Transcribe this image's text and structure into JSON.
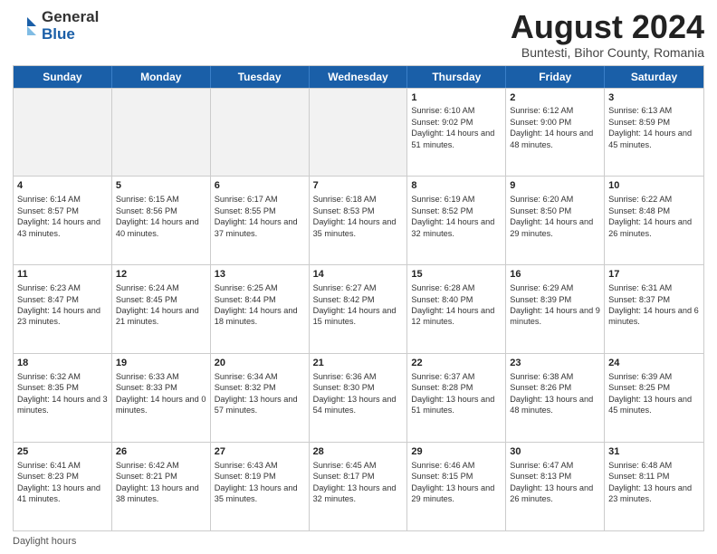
{
  "header": {
    "logo_line1": "General",
    "logo_line2": "Blue",
    "month_title": "August 2024",
    "subtitle": "Buntesti, Bihor County, Romania"
  },
  "calendar": {
    "days_of_week": [
      "Sunday",
      "Monday",
      "Tuesday",
      "Wednesday",
      "Thursday",
      "Friday",
      "Saturday"
    ],
    "rows": [
      [
        {
          "day": "",
          "info": "",
          "shaded": true
        },
        {
          "day": "",
          "info": "",
          "shaded": true
        },
        {
          "day": "",
          "info": "",
          "shaded": true
        },
        {
          "day": "",
          "info": "",
          "shaded": true
        },
        {
          "day": "1",
          "info": "Sunrise: 6:10 AM\nSunset: 9:02 PM\nDaylight: 14 hours and 51 minutes.",
          "shaded": false
        },
        {
          "day": "2",
          "info": "Sunrise: 6:12 AM\nSunset: 9:00 PM\nDaylight: 14 hours and 48 minutes.",
          "shaded": false
        },
        {
          "day": "3",
          "info": "Sunrise: 6:13 AM\nSunset: 8:59 PM\nDaylight: 14 hours and 45 minutes.",
          "shaded": false
        }
      ],
      [
        {
          "day": "4",
          "info": "Sunrise: 6:14 AM\nSunset: 8:57 PM\nDaylight: 14 hours and 43 minutes.",
          "shaded": false
        },
        {
          "day": "5",
          "info": "Sunrise: 6:15 AM\nSunset: 8:56 PM\nDaylight: 14 hours and 40 minutes.",
          "shaded": false
        },
        {
          "day": "6",
          "info": "Sunrise: 6:17 AM\nSunset: 8:55 PM\nDaylight: 14 hours and 37 minutes.",
          "shaded": false
        },
        {
          "day": "7",
          "info": "Sunrise: 6:18 AM\nSunset: 8:53 PM\nDaylight: 14 hours and 35 minutes.",
          "shaded": false
        },
        {
          "day": "8",
          "info": "Sunrise: 6:19 AM\nSunset: 8:52 PM\nDaylight: 14 hours and 32 minutes.",
          "shaded": false
        },
        {
          "day": "9",
          "info": "Sunrise: 6:20 AM\nSunset: 8:50 PM\nDaylight: 14 hours and 29 minutes.",
          "shaded": false
        },
        {
          "day": "10",
          "info": "Sunrise: 6:22 AM\nSunset: 8:48 PM\nDaylight: 14 hours and 26 minutes.",
          "shaded": false
        }
      ],
      [
        {
          "day": "11",
          "info": "Sunrise: 6:23 AM\nSunset: 8:47 PM\nDaylight: 14 hours and 23 minutes.",
          "shaded": false
        },
        {
          "day": "12",
          "info": "Sunrise: 6:24 AM\nSunset: 8:45 PM\nDaylight: 14 hours and 21 minutes.",
          "shaded": false
        },
        {
          "day": "13",
          "info": "Sunrise: 6:25 AM\nSunset: 8:44 PM\nDaylight: 14 hours and 18 minutes.",
          "shaded": false
        },
        {
          "day": "14",
          "info": "Sunrise: 6:27 AM\nSunset: 8:42 PM\nDaylight: 14 hours and 15 minutes.",
          "shaded": false
        },
        {
          "day": "15",
          "info": "Sunrise: 6:28 AM\nSunset: 8:40 PM\nDaylight: 14 hours and 12 minutes.",
          "shaded": false
        },
        {
          "day": "16",
          "info": "Sunrise: 6:29 AM\nSunset: 8:39 PM\nDaylight: 14 hours and 9 minutes.",
          "shaded": false
        },
        {
          "day": "17",
          "info": "Sunrise: 6:31 AM\nSunset: 8:37 PM\nDaylight: 14 hours and 6 minutes.",
          "shaded": false
        }
      ],
      [
        {
          "day": "18",
          "info": "Sunrise: 6:32 AM\nSunset: 8:35 PM\nDaylight: 14 hours and 3 minutes.",
          "shaded": false
        },
        {
          "day": "19",
          "info": "Sunrise: 6:33 AM\nSunset: 8:33 PM\nDaylight: 14 hours and 0 minutes.",
          "shaded": false
        },
        {
          "day": "20",
          "info": "Sunrise: 6:34 AM\nSunset: 8:32 PM\nDaylight: 13 hours and 57 minutes.",
          "shaded": false
        },
        {
          "day": "21",
          "info": "Sunrise: 6:36 AM\nSunset: 8:30 PM\nDaylight: 13 hours and 54 minutes.",
          "shaded": false
        },
        {
          "day": "22",
          "info": "Sunrise: 6:37 AM\nSunset: 8:28 PM\nDaylight: 13 hours and 51 minutes.",
          "shaded": false
        },
        {
          "day": "23",
          "info": "Sunrise: 6:38 AM\nSunset: 8:26 PM\nDaylight: 13 hours and 48 minutes.",
          "shaded": false
        },
        {
          "day": "24",
          "info": "Sunrise: 6:39 AM\nSunset: 8:25 PM\nDaylight: 13 hours and 45 minutes.",
          "shaded": false
        }
      ],
      [
        {
          "day": "25",
          "info": "Sunrise: 6:41 AM\nSunset: 8:23 PM\nDaylight: 13 hours and 41 minutes.",
          "shaded": false
        },
        {
          "day": "26",
          "info": "Sunrise: 6:42 AM\nSunset: 8:21 PM\nDaylight: 13 hours and 38 minutes.",
          "shaded": false
        },
        {
          "day": "27",
          "info": "Sunrise: 6:43 AM\nSunset: 8:19 PM\nDaylight: 13 hours and 35 minutes.",
          "shaded": false
        },
        {
          "day": "28",
          "info": "Sunrise: 6:45 AM\nSunset: 8:17 PM\nDaylight: 13 hours and 32 minutes.",
          "shaded": false
        },
        {
          "day": "29",
          "info": "Sunrise: 6:46 AM\nSunset: 8:15 PM\nDaylight: 13 hours and 29 minutes.",
          "shaded": false
        },
        {
          "day": "30",
          "info": "Sunrise: 6:47 AM\nSunset: 8:13 PM\nDaylight: 13 hours and 26 minutes.",
          "shaded": false
        },
        {
          "day": "31",
          "info": "Sunrise: 6:48 AM\nSunset: 8:11 PM\nDaylight: 13 hours and 23 minutes.",
          "shaded": false
        }
      ]
    ]
  },
  "footer": {
    "text": "Daylight hours"
  }
}
